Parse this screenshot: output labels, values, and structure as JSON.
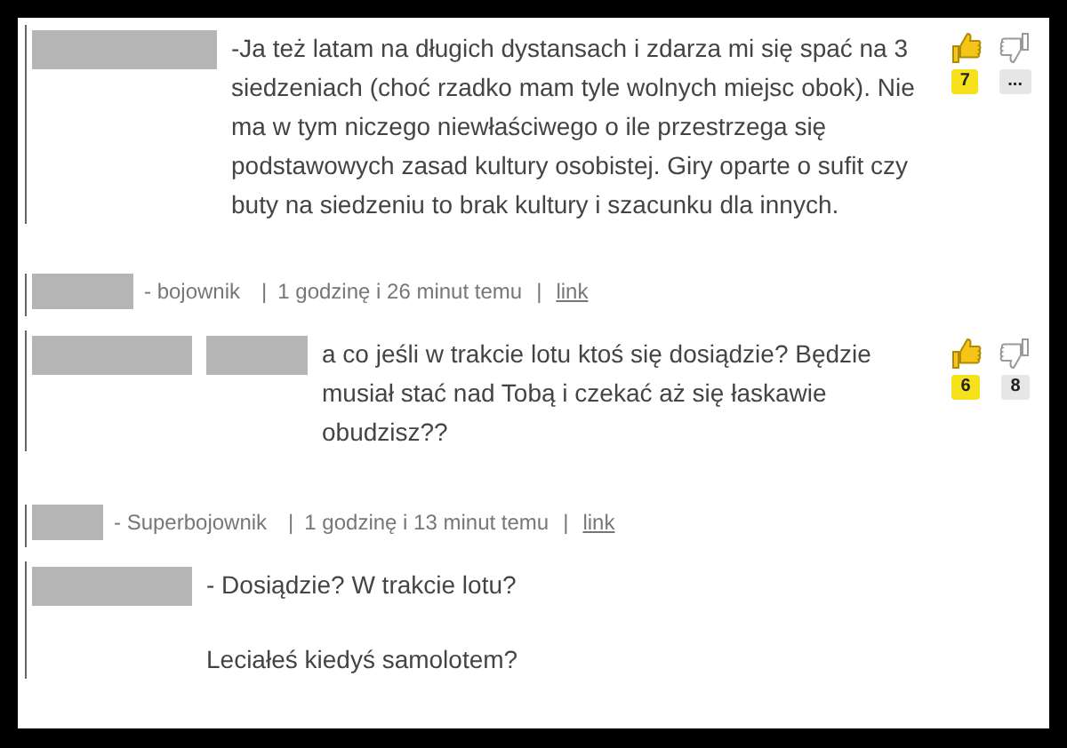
{
  "thread": [
    {
      "kind": "comment",
      "redactions": [
        {
          "kind": "long"
        }
      ],
      "paragraphs": [
        "-Ja też latam na długich dystansach i zdarza mi się spać na 3 siedzeniach (choć rzadko mam tyle wolnych miejsc obok). Nie ma w tym niczego niewłaściwego o ile przestrzega się podstawowych zasad kultury osobistej. Giry oparte o sufit czy buty na siedzeniu to brak kultury i szacunku dla innych."
      ],
      "votes": {
        "up": "7",
        "down": "..."
      }
    },
    {
      "kind": "meta",
      "redactions": [
        {
          "kind": "mid"
        }
      ],
      "rank": "- bojownik",
      "separator": "|",
      "time": "1 godzinę i 26 minut temu",
      "separator_2": "|",
      "link": "link"
    },
    {
      "kind": "comment",
      "redactions": [
        {
          "kind": "wide"
        },
        {
          "kind": "mid"
        }
      ],
      "paragraphs": [
        "a co jeśli w trakcie lotu ktoś się dosiądzie? Będzie musiał stać nad Tobą i czekać aż się łaskawie obudzisz??"
      ],
      "votes": {
        "up": "6",
        "down": "8"
      }
    },
    {
      "kind": "meta",
      "redactions": [
        {
          "kind": "short"
        }
      ],
      "rank": "- Superbojownik",
      "separator": "|",
      "time": "1 godzinę i 13 minut temu",
      "separator_2": "|",
      "link": "link"
    },
    {
      "kind": "comment",
      "redactions": [
        {
          "kind": "wide"
        }
      ],
      "paragraphs": [
        "- Dosiądzie? W trakcie lotu?",
        "Leciałeś kiedyś samolotem?"
      ]
    }
  ]
}
